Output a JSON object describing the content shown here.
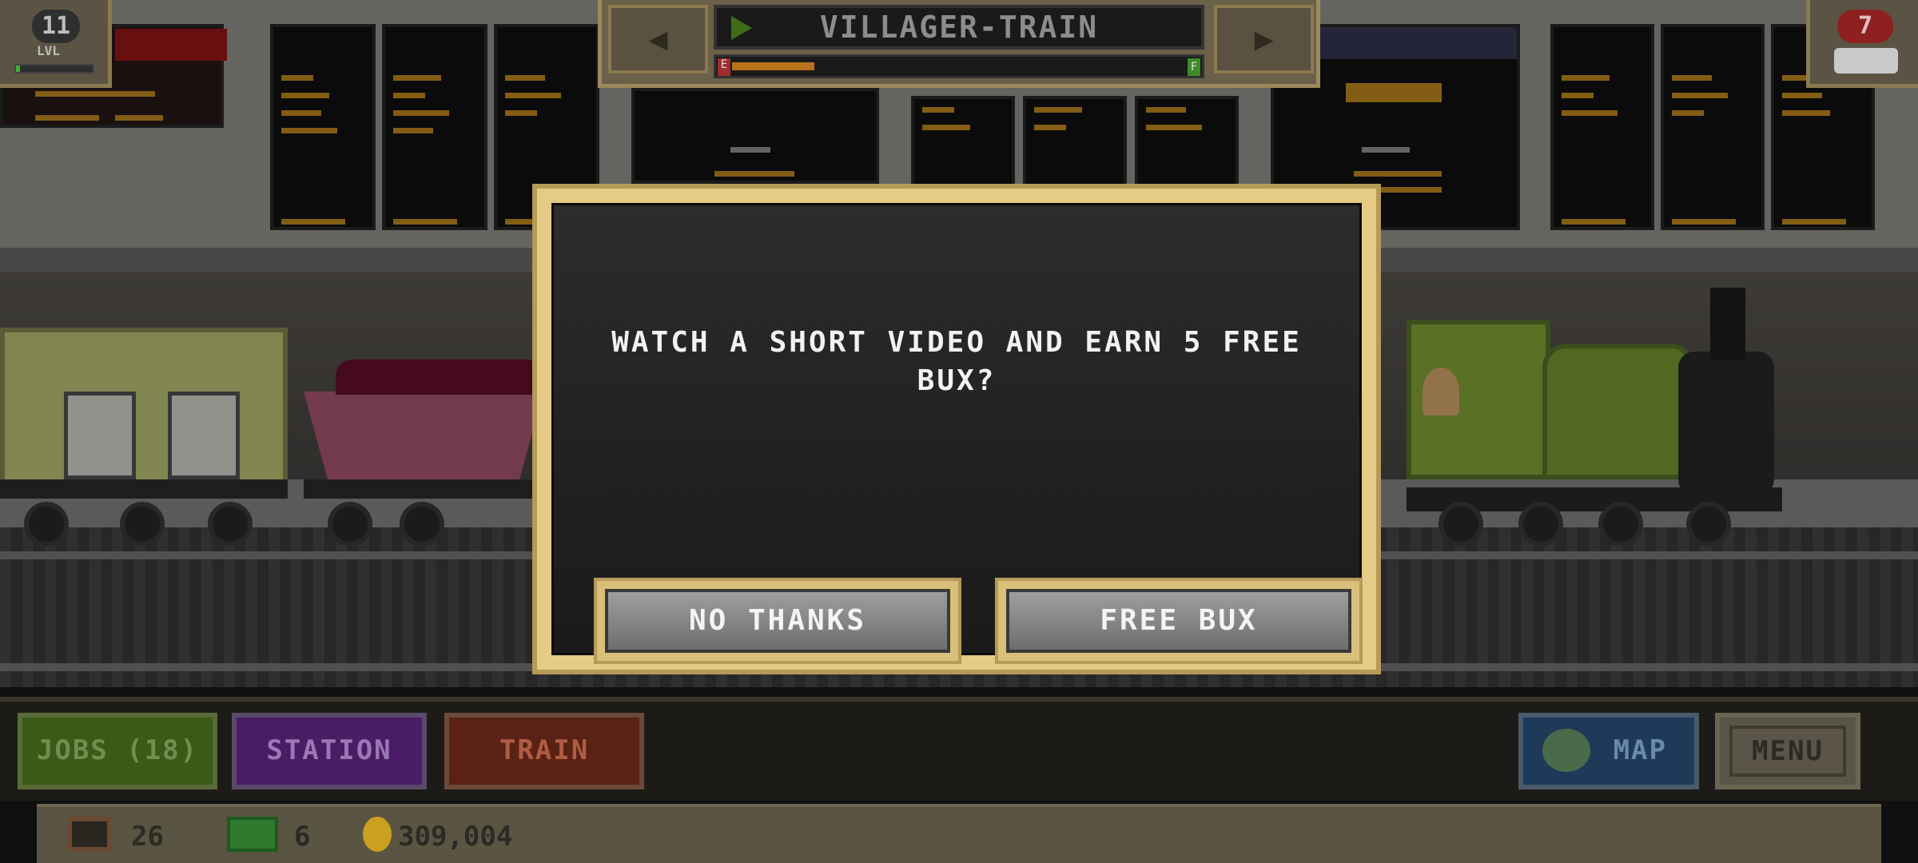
{
  "hud": {
    "level": "11",
    "level_label": "LVL",
    "level_progress": 0.05,
    "alerts_count": "7"
  },
  "train_selector": {
    "name": "VILLAGER-TRAIN",
    "fuel_low_label": "E",
    "fuel_full_label": "F",
    "fuel_fraction": 0.18,
    "prev_icon": "triangle-left-icon",
    "next_icon": "triangle-right-icon"
  },
  "dialog": {
    "message": "WATCH A SHORT VIDEO AND EARN 5 FREE BUX?",
    "decline_label": "NO THANKS",
    "accept_label": "FREE BUX"
  },
  "bottom_nav": {
    "jobs_label": "JOBS (18)",
    "station_label": "STATION",
    "train_label": "TRAIN",
    "map_label": "MAP",
    "menu_label": "MENU"
  },
  "resources": {
    "crates": "26",
    "bux": "6",
    "coins": "309,004"
  },
  "colors": {
    "modal_border": "#e5cb85",
    "jobs": "#3a5a18",
    "station": "#4a1c66",
    "train": "#5a2214",
    "map": "#1e3a58",
    "board_text": "#c9901f"
  }
}
